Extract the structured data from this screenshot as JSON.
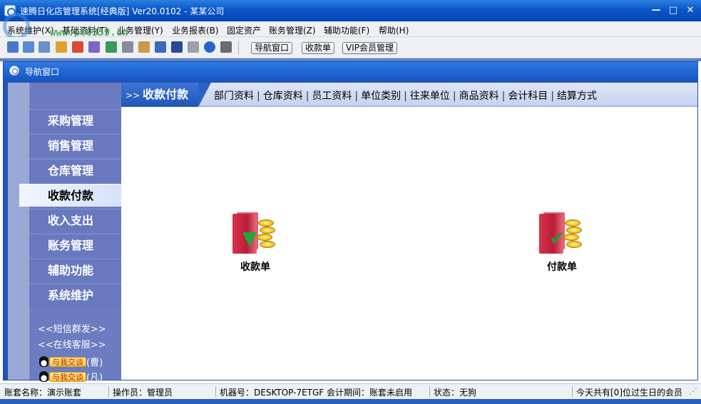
{
  "window": {
    "title": "速腾日化店管理系统[经典版] Ver20.0102 - 某某公司",
    "minimize": "—",
    "maximize": "□",
    "close": "✕"
  },
  "watermark": "www.pc0359.cn",
  "menu": [
    "系统维护(X)",
    "基础资料(T)",
    "业务管理(Y)",
    "业务报表(B)",
    "固定资产",
    "账务管理(Z)",
    "辅助功能(F)",
    "帮助(H)"
  ],
  "toolbar": {
    "buttons": [
      "导航窗口",
      "收款单",
      "VIP会员管理"
    ]
  },
  "inner_window": {
    "title": "导航窗口"
  },
  "sidebar": {
    "items": [
      "采购管理",
      "销售管理",
      "仓库管理",
      "收款付款",
      "收入支出",
      "账务管理",
      "辅助功能",
      "系统维护"
    ],
    "active": "收款付款",
    "links": [
      "<<短信群发>>",
      "<<在线客服>>"
    ],
    "qq": [
      {
        "chat": "与我交谈",
        "name": "(曹)"
      },
      {
        "chat": "与我交谈",
        "name": "(凡)"
      }
    ]
  },
  "main": {
    "arrow": ">>",
    "current": "收款付款",
    "links": [
      "部门资料",
      "仓库资料",
      "员工资料",
      "单位类别",
      "往来单位",
      "商品资料",
      "会计科目",
      "结算方式"
    ],
    "functions": [
      {
        "label": "收款单",
        "icon": "receipt-folder-icon"
      },
      {
        "label": "付款单",
        "icon": "payment-folder-icon"
      }
    ]
  },
  "status": {
    "account": "账套名称：演示账套",
    "operator": "操作员：管理员",
    "machine": "机器号：DESKTOP-7ETGF",
    "period": "会计期间：账套未启用",
    "state": "状态：无狗",
    "birthday": "今天共有[0]位过生日的会员"
  }
}
